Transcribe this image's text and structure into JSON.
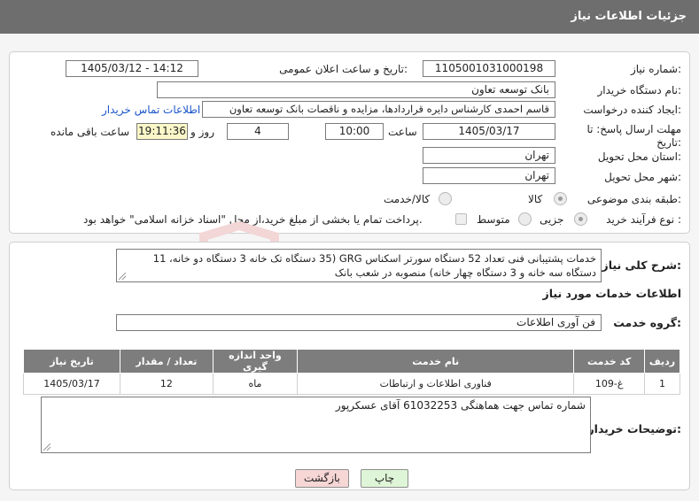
{
  "page": {
    "title": "جزئیات اطلاعات نیاز"
  },
  "form": {
    "need_number": {
      "label": "شماره نیاز:",
      "value": "1105001031000198"
    },
    "announce_datetime": {
      "label": "تاریخ و ساعت اعلان عمومی:",
      "value": "1405/03/12 - 14:12"
    },
    "buyer_org": {
      "label": "نام دستگاه خریدار:",
      "value": "بانک توسعه تعاون"
    },
    "creator": {
      "label": "ایجاد کننده درخواست:",
      "value": "قاسم احمدی کارشناس دایره قراردادها، مزایده و ناقصات  بانک توسعه تعاون",
      "contact_link": "اطلاعات تماس خریدار"
    },
    "deadline": {
      "label": "مهلت ارسال پاسخ: تا تاریخ:",
      "date": "1405/03/17",
      "time_label": "ساعت",
      "time": "10:00",
      "days": "4",
      "days_label": "روز و",
      "remaining": "19:11:36",
      "remaining_label": "ساعت باقی مانده"
    },
    "province": {
      "label": "استان محل تحویل:",
      "value": "تهران"
    },
    "city": {
      "label": "شهر محل تحویل:",
      "value": "تهران"
    },
    "category": {
      "label": "طبقه بندی موضوعی:",
      "options": [
        "کالا",
        "کالا/خدمت"
      ],
      "selected": "کالا"
    },
    "purchase_type": {
      "label": "نوع فرآیند خرید :",
      "options": [
        "جزیی",
        "متوسط"
      ],
      "selected": "جزیی",
      "treasury_note": "پرداخت تمام یا بخشی از مبلغ خرید،از محل \"اسناد خزانه اسلامی\" خواهد بود."
    }
  },
  "summary": {
    "label": "شرح کلی نیاز:",
    "text": "خدمات پشتیبانی فنی تعداد 52 دستگاه سورتر اسکناس GRG (35 دستگاه تک خانه  3 دستگاه دو خانه، 11 دستگاه سه خانه و 3 دستگاه چهار خانه) منصوبه در شعب بانک"
  },
  "services": {
    "heading": "اطلاعات خدمات مورد نیاز",
    "group_label": "گروه خدمت:",
    "group_value": "فن آوری اطلاعات",
    "columns": [
      "ردیف",
      "کد خدمت",
      "نام خدمت",
      "واحد اندازه گیری",
      "تعداد / مقدار",
      "تاریخ نیاز"
    ],
    "rows": [
      [
        "1",
        "غ-109",
        "فناوری اطلاعات و ارتباطات",
        "ماه",
        "12",
        "1405/03/17"
      ]
    ]
  },
  "buyer_notes": {
    "label": "توضیحات خریدار:",
    "text": "شماره تماس جهت هماهنگی 61032253 آقای عسکرپور"
  },
  "buttons": {
    "print": "چاپ",
    "back": "بازگشت"
  },
  "colors": {
    "header_bg": "#6e6e6e",
    "link": "#1a55c8",
    "remaining_bg": "#fbf7c8",
    "back_button_bg": "#f7d6d6",
    "print_button_bg": "#dff5d7"
  }
}
